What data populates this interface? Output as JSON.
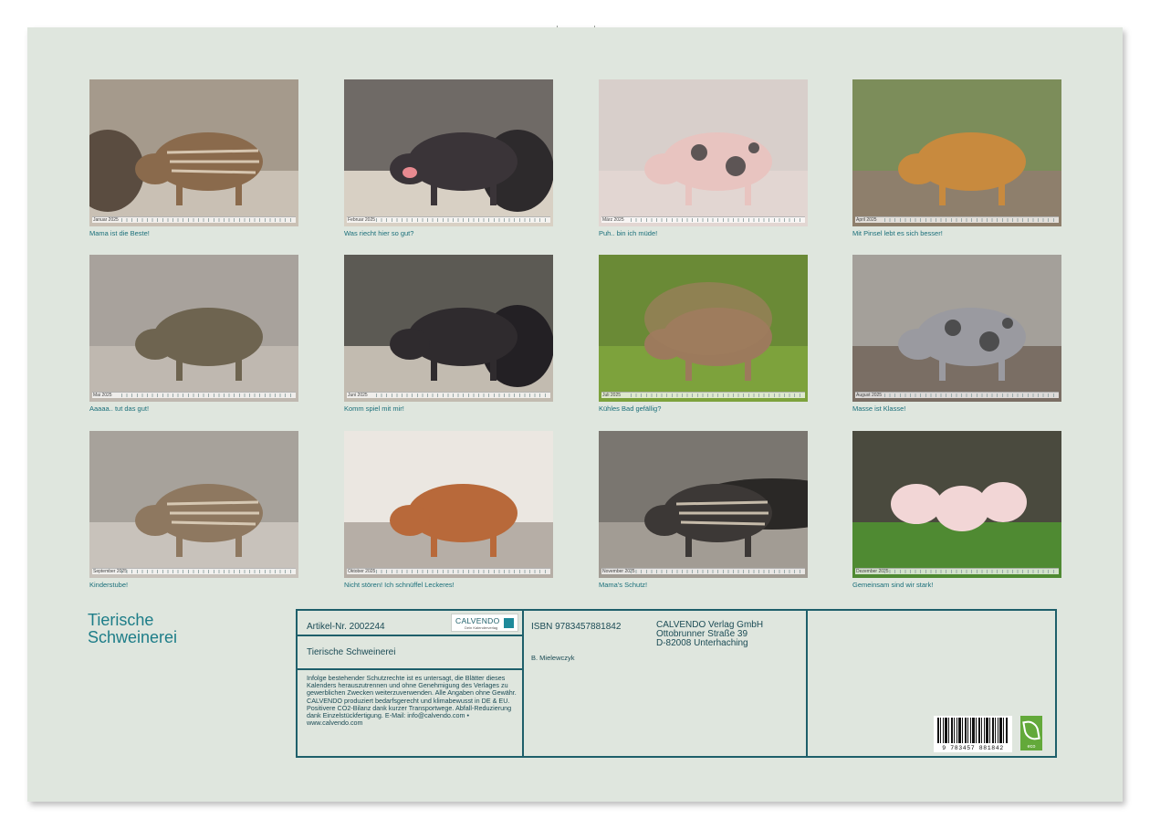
{
  "captions": [
    "Mama ist die Beste!",
    "Was riecht hier so gut?",
    "Puh.. bin ich müde!",
    "Mit Pinsel lebt es sich besser!",
    "Aaaaa.. tut das gut!",
    "Komm spiel mit mir!",
    "Kühles Bad gefällig?",
    "Masse ist Klasse!",
    "Kinderstube!",
    "Nicht stören! Ich schnüffel Leckeres!",
    "Mama's Schutz!",
    "Gemeinsam sind wir stark!"
  ],
  "months": [
    "Januar 2025",
    "Februar 2025",
    "März 2025",
    "April 2025",
    "Mai 2025",
    "Juni 2025",
    "Juli 2025",
    "August 2025",
    "September 2025",
    "Oktober 2025",
    "November 2025",
    "Dezember 2025"
  ],
  "title_line1": "Tierische",
  "title_line2": "Schweinerei",
  "info": {
    "article": "Artikel-Nr. 2002244",
    "logo_name": "CALVENDO",
    "logo_tag": "Dein Kalenderverlag",
    "product_title": "Tierische Schweinerei",
    "legal": "Infolge bestehender Schutzrechte ist es untersagt, die Blätter dieses Kalenders herauszutrennen und ohne Genehmigung des Verlages zu gewerblichen Zwecken weiterzuverwenden. Alle Angaben ohne Gewähr. CALVENDO produziert bedarfsgerecht und klimabewusst in DE & EU. Positivere CO2-Bilanz dank kurzer Transportwege. Abfall-Reduzierung dank Einzelstückfertigung. E-Mail: info@calvendo.com • www.calvendo.com",
    "isbn": "ISBN 9783457881842",
    "author": "B. Mielewczyk",
    "publisher_line1": "CALVENDO Verlag GmbH",
    "publisher_line2": "Ottobrunner Straße 39",
    "publisher_line3": "D-82008 Unterhaching",
    "barcode_number": "9 783457 881842",
    "eco_label": "eco"
  },
  "colors": {
    "page_bg": "#dfe6de",
    "accent_teal": "#1d7d88",
    "box_border": "#1e5f6a"
  }
}
